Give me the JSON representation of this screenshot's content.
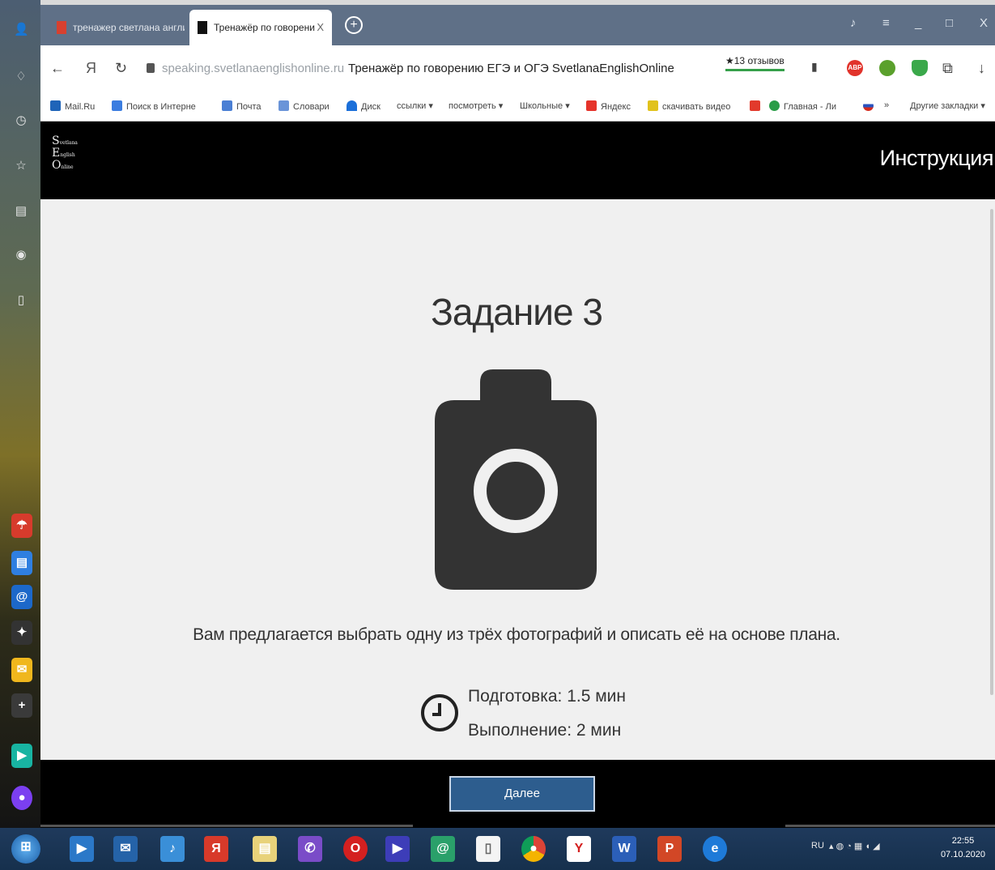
{
  "browser": {
    "tabs": [
      {
        "label": "тренажер светлана англи",
        "active": false
      },
      {
        "label": "Тренажёр по говорени",
        "active": true,
        "close": "X"
      }
    ],
    "new_tab_symbol": "+",
    "window_controls": {
      "minimize": "_",
      "maximize": "□",
      "close": "X"
    },
    "address": {
      "domain": "speaking.svetlanaenglishonline.ru",
      "page_title": "Тренажёр по говорению ЕГЭ и ОГЭ SvetlanaEnglishOnline",
      "reviews": "★13 отзывов"
    },
    "extensions": [
      {
        "icon": "adblock-icon",
        "label": "ABP",
        "color": "#e1332b"
      },
      {
        "icon": "bug-icon",
        "label": "",
        "color": "#5aa02c"
      },
      {
        "icon": "shield-icon",
        "label": "",
        "color": "#3aa84a"
      }
    ],
    "bookmarks": [
      {
        "label": "Mail.Ru",
        "color": "#1f64b8"
      },
      {
        "label": "Поиск в Интерне",
        "color": "#3b7de0"
      },
      {
        "label": "Почта",
        "color": "#4a7fd4"
      },
      {
        "label": "Словари",
        "color": "#6a94d8"
      },
      {
        "label": "Диск",
        "color": "#1b6fd9"
      },
      {
        "label": "ссылки ▾",
        "color": ""
      },
      {
        "label": "посмотреть ▾",
        "color": ""
      },
      {
        "label": "Школьные ▾",
        "color": ""
      },
      {
        "label": "Яндекс",
        "color": "#e5332a"
      },
      {
        "label": "скачивать видео",
        "color": "#e1c21c"
      },
      {
        "label": "",
        "color": "#e23a2c"
      },
      {
        "label": "Главная - Ли",
        "color": "#2a9d47"
      },
      {
        "label": "»",
        "color": ""
      },
      {
        "label": "Другие закладки ▾",
        "color": ""
      }
    ]
  },
  "site": {
    "header": {
      "instruction_link": "Инструкция",
      "logo_text": "Svetlana English Online"
    },
    "task": {
      "title": "Задание 3",
      "description": "Вам предлагается выбрать одну из трёх фотографий и описать её на основе плана.",
      "preparation": "Подготовка: 1.5 мин",
      "execution": "Выполнение: 2 мин"
    },
    "footer": {
      "next_button": "Далее"
    }
  },
  "taskbar": {
    "language": "RU",
    "time": "22:55",
    "date": "07.10.2020"
  },
  "colors": {
    "header_bg": "#000000",
    "content_bg": "#f0f0f0",
    "button_bg": "#2d5d8e",
    "icon_dark": "#333333"
  }
}
